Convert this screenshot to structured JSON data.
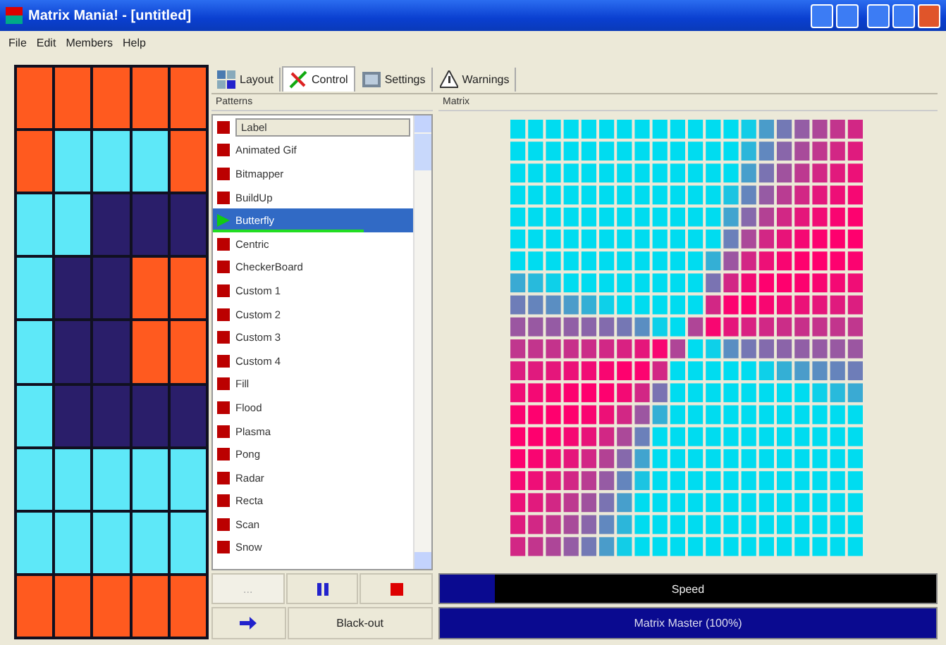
{
  "window": {
    "title": "Matrix Mania! - [untitled]"
  },
  "menu": [
    "File",
    "Edit",
    "Members",
    "Help"
  ],
  "tabs": [
    {
      "label": "Layout",
      "selected": false,
      "kind": "layout"
    },
    {
      "label": "Control",
      "selected": true,
      "kind": "control"
    },
    {
      "label": "Settings",
      "selected": false,
      "kind": "settings"
    },
    {
      "label": "Warnings",
      "selected": false,
      "kind": "warnings"
    }
  ],
  "patterns": {
    "heading": "Patterns",
    "items": [
      {
        "label": "Label",
        "kind": "edit",
        "selected": false,
        "playing": false
      },
      {
        "label": "Animated Gif",
        "kind": "pattern",
        "selected": false,
        "playing": false
      },
      {
        "label": "Bitmapper",
        "kind": "pattern",
        "selected": false,
        "playing": false
      },
      {
        "label": "BuildUp",
        "kind": "pattern",
        "selected": false,
        "playing": false
      },
      {
        "label": "Butterfly",
        "kind": "pattern",
        "selected": true,
        "playing": true,
        "level": 0.75
      },
      {
        "label": "Centric",
        "kind": "pattern",
        "selected": false,
        "playing": false
      },
      {
        "label": "CheckerBoard",
        "kind": "pattern",
        "selected": false,
        "playing": false
      },
      {
        "label": "Custom 1",
        "kind": "pattern",
        "selected": false,
        "playing": false
      },
      {
        "label": "Custom 2",
        "kind": "pattern",
        "selected": false,
        "playing": false
      },
      {
        "label": "Custom 3",
        "kind": "pattern",
        "selected": false,
        "playing": false
      },
      {
        "label": "Custom 4",
        "kind": "pattern",
        "selected": false,
        "playing": false
      },
      {
        "label": "Fill",
        "kind": "pattern",
        "selected": false,
        "playing": false
      },
      {
        "label": "Flood",
        "kind": "pattern",
        "selected": false,
        "playing": false
      },
      {
        "label": "Plasma",
        "kind": "pattern",
        "selected": false,
        "playing": false
      },
      {
        "label": "Pong",
        "kind": "pattern",
        "selected": false,
        "playing": false
      },
      {
        "label": "Radar",
        "kind": "pattern",
        "selected": false,
        "playing": false
      },
      {
        "label": "Recta",
        "kind": "pattern",
        "selected": false,
        "playing": false
      },
      {
        "label": "Scan",
        "kind": "pattern",
        "selected": false,
        "playing": false
      },
      {
        "label": "Snow",
        "kind": "pattern",
        "selected": false,
        "playing": false
      }
    ]
  },
  "matrix": {
    "heading": "Matrix"
  },
  "controls": [
    {
      "kind": "more",
      "label": "...",
      "disabled": true
    },
    {
      "kind": "pause",
      "disabled": false
    },
    {
      "kind": "stop",
      "disabled": false
    },
    {
      "kind": "go",
      "disabled": false
    },
    {
      "kind": "text",
      "label": "Black-out",
      "disabled": false
    }
  ],
  "speed": {
    "label": "Speed",
    "level": 0.11
  },
  "status_bar": {
    "text": "Matrix Master (100%)"
  }
}
